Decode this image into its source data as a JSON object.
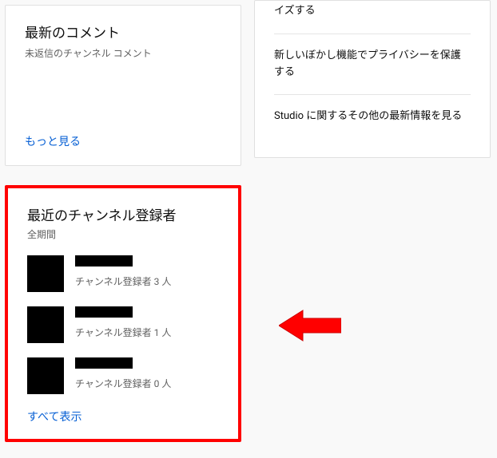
{
  "comments": {
    "title": "最新のコメント",
    "subtitle": "未返信のチャンネル コメント",
    "link": "もっと見る"
  },
  "news": {
    "items": [
      "イズする",
      "新しいぼかし機能でプライバシーを保護する",
      "Studio に関するその他の最新情報を見る"
    ]
  },
  "subscribers": {
    "title": "最近のチャンネル登録者",
    "period": "全期間",
    "items": [
      {
        "count": "チャンネル登録者 3 人"
      },
      {
        "count": "チャンネル登録者 1 人"
      },
      {
        "count": "チャンネル登録者 0 人"
      }
    ],
    "link": "すべて表示"
  }
}
